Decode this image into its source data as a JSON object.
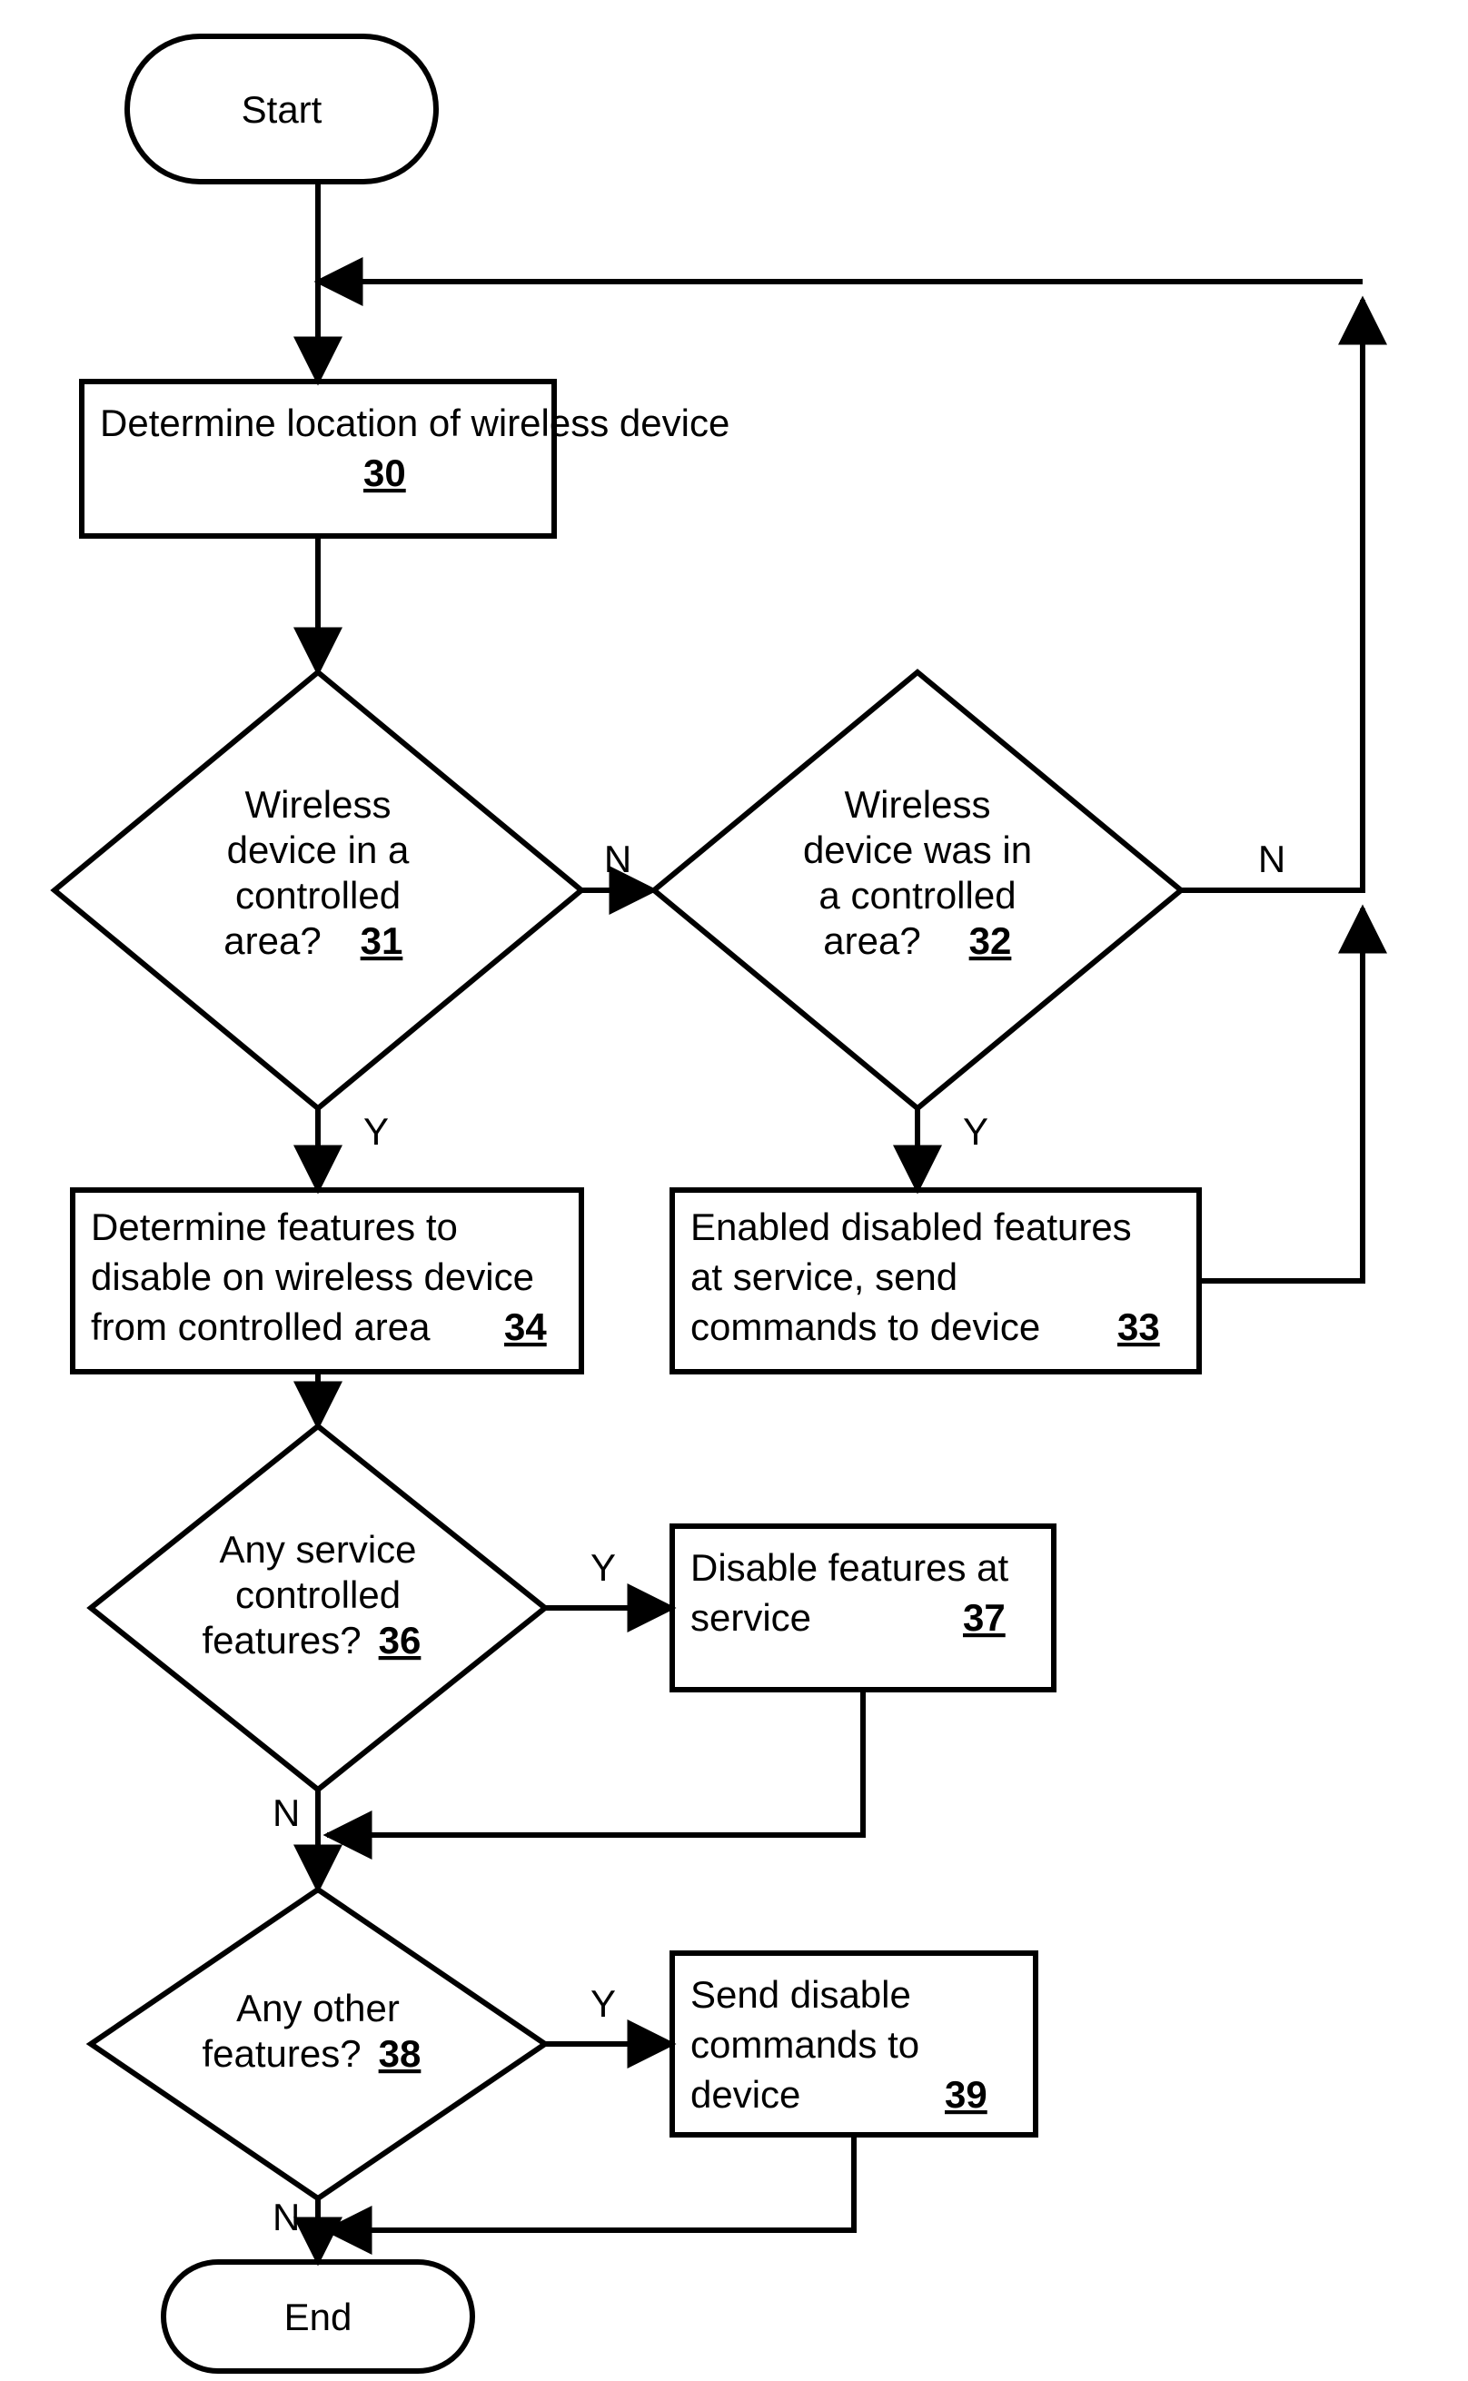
{
  "nodes": {
    "start": {
      "label": "Start"
    },
    "end": {
      "label": "End"
    },
    "n30": {
      "text": "Determine location of wireless device",
      "ref": "30"
    },
    "n31": {
      "l1": "Wireless",
      "l2": "device in a",
      "l3": "controlled",
      "l4": "area?",
      "ref": "31"
    },
    "n32": {
      "l1": "Wireless",
      "l2": "device was in",
      "l3": "a controlled",
      "l4": "area?",
      "ref": "32"
    },
    "n33": {
      "text1": "Enabled disabled features",
      "text2": "at service, send",
      "text3": "commands to device",
      "ref": "33"
    },
    "n34": {
      "text1": "Determine features to",
      "text2": "disable on wireless device",
      "text3": "from controlled area",
      "ref": "34"
    },
    "n36": {
      "l1": "Any service",
      "l2": "controlled",
      "l3": "features?",
      "ref": "36"
    },
    "n37": {
      "text1": "Disable features at",
      "text2": "service",
      "ref": "37"
    },
    "n38": {
      "l1": "Any other",
      "l2": "features?",
      "ref": "38"
    },
    "n39": {
      "text1": "Send disable",
      "text2": "commands to",
      "text3": "device",
      "ref": "39"
    }
  },
  "labels": {
    "Y": "Y",
    "N": "N"
  }
}
